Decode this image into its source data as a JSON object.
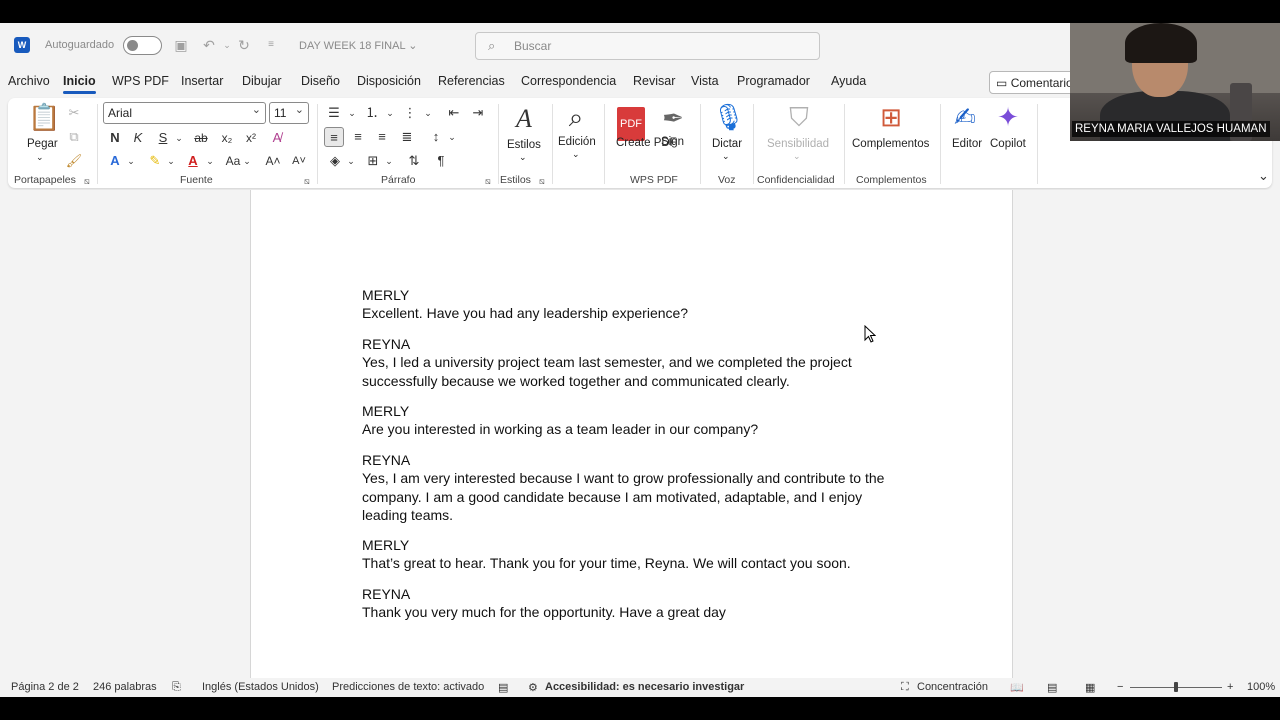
{
  "titlebar": {
    "app_icon": "word-icon",
    "autosave_label": "Autoguardado",
    "autosave_state": "off",
    "doc_title": "DAY WEEK 18 FINAL",
    "search_placeholder": "Buscar"
  },
  "menu": {
    "items": [
      "Archivo",
      "Inicio",
      "WPS PDF",
      "Insertar",
      "Dibujar",
      "Diseño",
      "Disposición",
      "Referencias",
      "Correspondencia",
      "Revisar",
      "Vista",
      "Programador",
      "Ayuda"
    ],
    "active": "Inicio",
    "comments_label": "Comentarios"
  },
  "ribbon": {
    "clipboard": {
      "paste": "Pegar",
      "group": "Portapapeles"
    },
    "font": {
      "name": "Arial",
      "size": "11",
      "bold": "N",
      "italic": "K",
      "underline": "S",
      "strike": "ab",
      "subscript": "x₂",
      "superscript": "x²",
      "group": "Fuente"
    },
    "paragraph": {
      "group": "Párrafo"
    },
    "styles": {
      "label": "Estilos",
      "group": "Estilos"
    },
    "editing": {
      "label": "Edición"
    },
    "wps": {
      "create_pdf": "Create PDF",
      "sign": "Sign",
      "group": "WPS PDF"
    },
    "voice": {
      "dictate": "Dictar",
      "group": "Voz"
    },
    "sensitivity": {
      "label": "Sensibilidad",
      "group": "Confidencialidad"
    },
    "addins": {
      "label": "Complementos",
      "group": "Complementos"
    },
    "editor": "Editor",
    "copilot": "Copilot"
  },
  "document": {
    "paragraphs": [
      "MERLY",
      "Excellent. Have you had any leadership experience?",
      " REYNA",
      "Yes, I led a university project team last semester, and we completed the project successfully because we worked together and communicated clearly.",
      " MERLY",
      "Are you interested in working as a team leader in our company?",
      " REYNA",
      "Yes, I am very interested because I want to grow professionally and contribute to the company. I am a good candidate because I am motivated, adaptable, and I enjoy leading teams.",
      " MERLY",
      "That’s great to hear. Thank you for your time, Reyna. We will contact you soon.",
      " REYNA",
      "Thank you very much for the opportunity. Have a great day"
    ]
  },
  "statusbar": {
    "page": "Página 2 de 2",
    "words": "246 palabras",
    "language": "Inglés (Estados Unidos)",
    "predictions": "Predicciones de texto: activado",
    "accessibility": "Accesibilidad: es necesario investigar",
    "focus": "Concentración",
    "zoom": "100%",
    "zoom_fraction": 0.5
  },
  "webcam": {
    "name": "REYNA MARIA VALLEJOS HUAMAN"
  }
}
